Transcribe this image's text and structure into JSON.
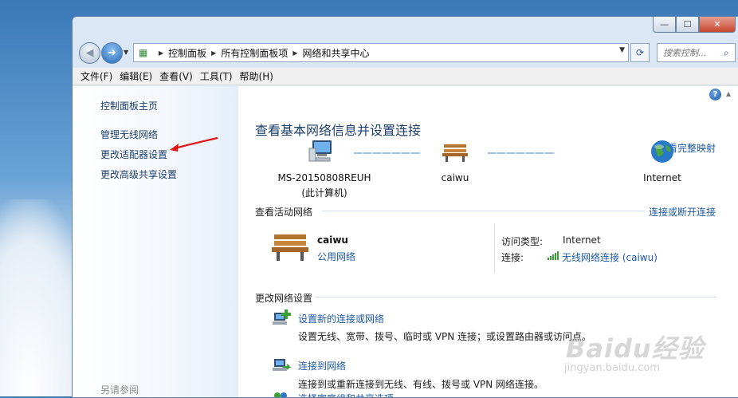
{
  "window": {
    "caption_buttons": [
      "—",
      "☐",
      "✕"
    ]
  },
  "navbar": {
    "crumbs": [
      "控制面板",
      "所有控制面板项",
      "网络和共享中心"
    ],
    "search_placeholder": "搜索控制..."
  },
  "menu": [
    "文件(F)",
    "编辑(E)",
    "查看(V)",
    "工具(T)",
    "帮助(H)"
  ],
  "sidebar": {
    "home": "控制面板主页",
    "links": [
      "管理无线网络",
      "更改适配器设置",
      "更改高级共享设置"
    ],
    "see_also": "另请参阅"
  },
  "main": {
    "title": "查看基本网络信息并设置连接",
    "full_map_link": "查看完整映射",
    "map": {
      "computer_name": "MS-20150808REUH",
      "computer_sub": "(此计算机)",
      "network_name": "caiwu",
      "internet": "Internet"
    },
    "active": {
      "header": "查看活动网络",
      "connect_link": "连接或断开连接",
      "name": "caiwu",
      "type": "公用网络",
      "access_type_label": "访问类型:",
      "access_type_value": "Internet",
      "connection_label": "连接:",
      "connection_value": "无线网络连接 (caiwu)"
    },
    "change": {
      "header": "更改网络设置",
      "tasks": [
        {
          "link": "设置新的连接或网络",
          "desc": "设置无线、宽带、拨号、临时或 VPN 连接；或设置路由器或访问点。"
        },
        {
          "link": "连接到网络",
          "desc": "连接到或重新连接到无线、有线、拨号或 VPN 网络连接。"
        },
        {
          "link": "选择家庭组和共享选项",
          "desc": ""
        }
      ]
    }
  },
  "watermark": {
    "brand": "Baidu经验",
    "url": "jingyan.baidu.com"
  },
  "icons": [
    "back-icon",
    "forward-icon",
    "control-panel-icon",
    "refresh-icon",
    "search-icon",
    "help-icon",
    "computer-icon",
    "bench-icon",
    "globe-icon",
    "signal-icon",
    "network-setup-icon",
    "connect-icon",
    "homegroup-icon",
    "red-arrow-annotation"
  ]
}
